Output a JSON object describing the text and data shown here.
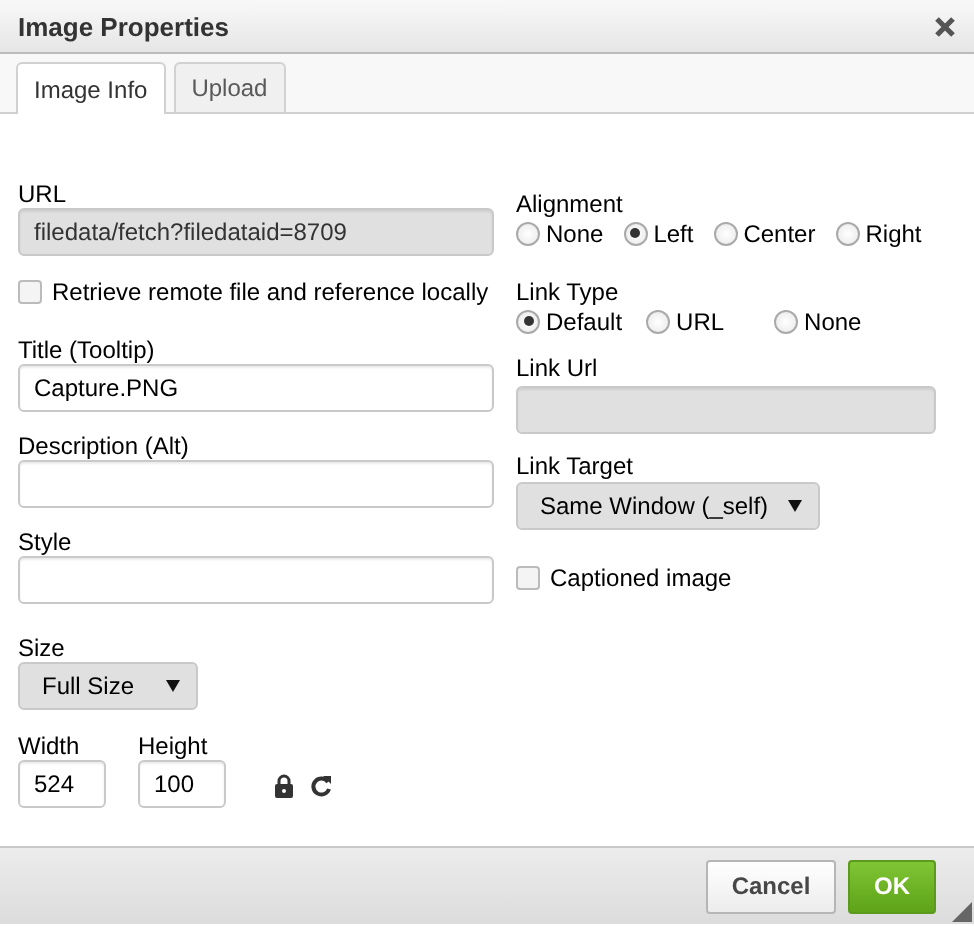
{
  "window": {
    "title": "Image Properties"
  },
  "tabs": [
    {
      "label": "Image Info",
      "selected": true
    },
    {
      "label": "Upload",
      "selected": false
    }
  ],
  "url": {
    "label": "URL",
    "value": "filedata/fetch?filedataid=8709",
    "disabled": true
  },
  "retrieve_remote": {
    "label": "Retrieve remote file and reference locally",
    "checked": false
  },
  "title_field": {
    "label": "Title (Tooltip)",
    "value": "Capture.PNG"
  },
  "description": {
    "label": "Description (Alt)"
  },
  "style": {
    "label": "Style"
  },
  "size": {
    "label": "Size",
    "value": "Full Size"
  },
  "width": {
    "label": "Width",
    "value": "524"
  },
  "height": {
    "label": "Height",
    "value": "100"
  },
  "alignment": {
    "label": "Alignment",
    "options": [
      {
        "label": "None",
        "selected": false
      },
      {
        "label": "Left",
        "selected": true
      },
      {
        "label": "Center",
        "selected": false
      },
      {
        "label": "Right",
        "selected": false
      }
    ]
  },
  "link_type": {
    "label": "Link Type",
    "options": [
      {
        "label": "Default",
        "selected": true
      },
      {
        "label": "URL",
        "selected": false
      },
      {
        "label": "None",
        "selected": false
      }
    ]
  },
  "link_url": {
    "label": "Link Url",
    "disabled": true
  },
  "link_target": {
    "label": "Link Target",
    "value": "Same Window (_self)"
  },
  "captioned": {
    "label": "Captioned image",
    "checked": false
  },
  "buttons": [
    {
      "label": "Cancel",
      "kind": "secondary"
    },
    {
      "label": "OK",
      "kind": "primary"
    }
  ]
}
